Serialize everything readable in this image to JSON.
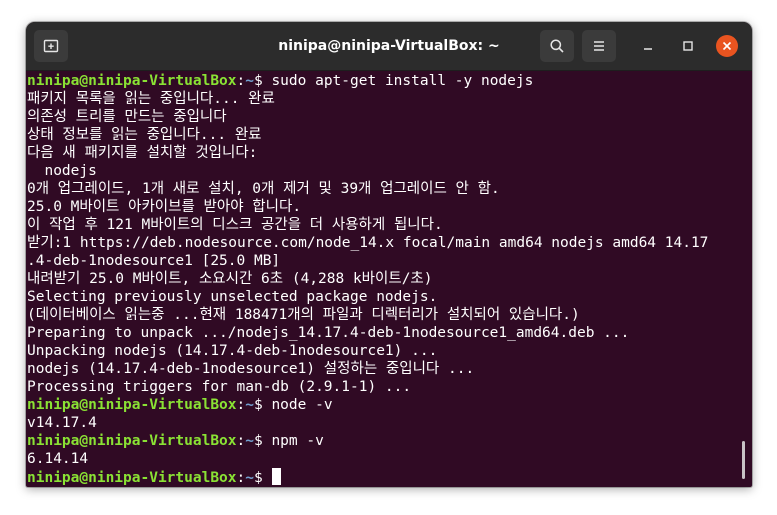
{
  "window": {
    "title": "ninipa@ninipa-VirtualBox: ~"
  },
  "prompt": {
    "user_host": "ninipa@ninipa-VirtualBox",
    "sep": ":",
    "path": "~",
    "symbol": "$ "
  },
  "commands": {
    "install": "sudo apt-get install -y nodejs",
    "node_version": "node -v",
    "npm_version": "npm -v"
  },
  "output": {
    "install": [
      "패키지 목록을 읽는 중입니다... 완료",
      "의존성 트리를 만드는 중입니다",
      "상태 정보를 읽는 중입니다... 완료",
      "다음 새 패키지를 설치할 것입니다:",
      "  nodejs",
      "0개 업그레이드, 1개 새로 설치, 0개 제거 및 39개 업그레이드 안 함.",
      "25.0 M바이트 아카이브를 받아야 합니다.",
      "이 작업 후 121 M바이트의 디스크 공간을 더 사용하게 됩니다.",
      "받기:1 https://deb.nodesource.com/node_14.x focal/main amd64 nodejs amd64 14.17",
      ".4-deb-1nodesource1 [25.0 MB]",
      "내려받기 25.0 M바이트, 소요시간 6초 (4,288 k바이트/초)",
      "Selecting previously unselected package nodejs.",
      "(데이터베이스 읽는중 ...현재 188471개의 파일과 디렉터리가 설치되어 있습니다.)",
      "Preparing to unpack .../nodejs_14.17.4-deb-1nodesource1_amd64.deb ...",
      "Unpacking nodejs (14.17.4-deb-1nodesource1) ...",
      "nodejs (14.17.4-deb-1nodesource1) 설정하는 중입니다 ...",
      "Processing triggers for man-db (2.9.1-1) ..."
    ],
    "node_version": "v14.17.4",
    "npm_version": "6.14.14"
  },
  "icons": {
    "new_tab": "new-tab-icon",
    "search": "search-icon",
    "menu": "hamburger-menu-icon",
    "minimize": "minimize-icon",
    "maximize": "maximize-icon",
    "close": "close-icon"
  },
  "colors": {
    "terminal_bg": "#300a24",
    "titlebar_bg": "#2c2c2c",
    "prompt_user": "#8ae234",
    "prompt_path": "#729fcf",
    "text": "#ffffff",
    "close_button": "#e95420"
  }
}
